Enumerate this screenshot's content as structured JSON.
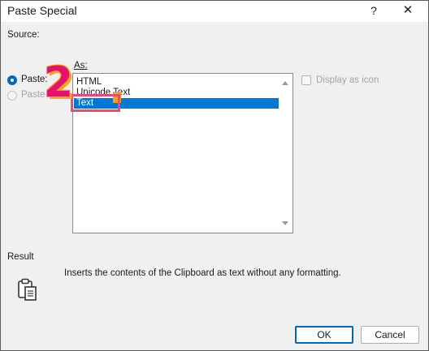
{
  "window": {
    "title": "Paste Special",
    "help_label": "?",
    "close_label": "✕"
  },
  "source_label": "Source:",
  "as_label": "As:",
  "paste_options": [
    {
      "label": "Paste:",
      "selected": true,
      "enabled": true
    },
    {
      "label": "Paste",
      "selected": false,
      "enabled": false
    }
  ],
  "formats": [
    {
      "label": "HTML",
      "selected": false
    },
    {
      "label": "Unicode Text",
      "selected": false
    },
    {
      "label": "Text",
      "selected": true
    }
  ],
  "display_as_icon": {
    "label": "Display as icon",
    "checked": false,
    "enabled": false
  },
  "result": {
    "label": "Result",
    "description": "Inserts the contents of the Clipboard as text without any formatting.",
    "icon": "clipboard-icon"
  },
  "buttons": {
    "ok": "OK",
    "cancel": "Cancel"
  },
  "annotation": {
    "step_number": "2"
  },
  "colors": {
    "accent": "#0067c0",
    "selection": "#0078d7",
    "annotation_pink": "#e2136e",
    "annotation_orange": "#f7a31c"
  }
}
